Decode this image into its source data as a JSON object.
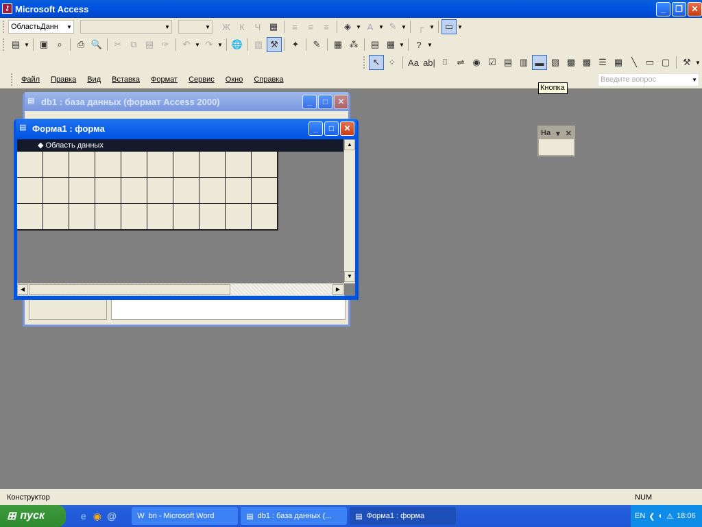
{
  "app": {
    "title": "Microsoft Access"
  },
  "toolbar_format": {
    "object_combo": "ОбластьДанн",
    "font_combo": "",
    "size_combo": "",
    "buttons": [
      {
        "name": "bold-icon",
        "g": "Ж",
        "d": 1
      },
      {
        "name": "italic-icon",
        "g": "К",
        "d": 1
      },
      {
        "name": "underline-icon",
        "g": "Ч",
        "d": 1
      },
      {
        "name": "table-format-icon",
        "g": "▦"
      },
      {
        "sep": 1
      },
      {
        "name": "align-left-icon",
        "g": "≡",
        "d": 1
      },
      {
        "name": "align-center-icon",
        "g": "≡",
        "d": 1
      },
      {
        "name": "align-right-icon",
        "g": "≡",
        "d": 1
      },
      {
        "sep": 1
      },
      {
        "name": "fill-color-icon",
        "g": "◈",
        "dd": 1
      },
      {
        "name": "font-color-icon",
        "g": "A",
        "d": 1,
        "dd": 1
      },
      {
        "name": "line-color-icon",
        "g": "✎",
        "d": 1,
        "dd": 1
      },
      {
        "sep": 1
      },
      {
        "name": "border-icon",
        "g": "┌",
        "d": 1,
        "dd": 1
      },
      {
        "sep": 1
      },
      {
        "name": "special-effect-icon",
        "g": "▭",
        "a": 1,
        "dd": 1
      }
    ]
  },
  "toolbar_design": {
    "buttons": [
      {
        "name": "view-icon",
        "g": "▤",
        "dd": 1
      },
      {
        "sep": 1
      },
      {
        "name": "save-icon",
        "g": "▣"
      },
      {
        "name": "search-file-icon",
        "g": "⌕"
      },
      {
        "sep": 1
      },
      {
        "name": "print-icon",
        "g": "⎙"
      },
      {
        "name": "print-preview-icon",
        "g": "🔍"
      },
      {
        "sep": 1
      },
      {
        "name": "cut-icon",
        "g": "✂",
        "d": 1
      },
      {
        "name": "copy-icon",
        "g": "⧉",
        "d": 1
      },
      {
        "name": "paste-icon",
        "g": "▤",
        "d": 1
      },
      {
        "name": "format-painter-icon",
        "g": "✑",
        "d": 1
      },
      {
        "sep": 1
      },
      {
        "name": "undo-icon",
        "g": "↶",
        "d": 1,
        "dd": 1
      },
      {
        "name": "redo-icon",
        "g": "↷",
        "d": 1,
        "dd": 1
      },
      {
        "sep": 1
      },
      {
        "name": "hyperlink-icon",
        "g": "🌐"
      },
      {
        "sep": 1
      },
      {
        "name": "field-list-icon",
        "g": "▥",
        "d": 1
      },
      {
        "name": "toolbox-icon",
        "g": "⚒",
        "a": 1
      },
      {
        "sep": 1
      },
      {
        "name": "autoformat-icon",
        "g": "✦"
      },
      {
        "sep": 1
      },
      {
        "name": "code-icon",
        "g": "✎"
      },
      {
        "sep": 1
      },
      {
        "name": "properties-icon",
        "g": "▦"
      },
      {
        "name": "builder-icon",
        "g": "⁂"
      },
      {
        "sep": 1
      },
      {
        "name": "database-window-icon",
        "g": "▤"
      },
      {
        "name": "new-object-icon",
        "g": "▦",
        "dd": 1
      },
      {
        "sep": 1
      },
      {
        "name": "help-icon",
        "g": "?",
        "dd": 1
      }
    ]
  },
  "toolbox": {
    "buttons": [
      {
        "name": "select-objects-icon",
        "g": "↖",
        "a": 1
      },
      {
        "name": "control-wizards-icon",
        "g": "⁘"
      },
      {
        "sep": 1
      },
      {
        "name": "label-icon",
        "g": "Aa"
      },
      {
        "name": "text-box-icon",
        "g": "ab|"
      },
      {
        "name": "option-group-icon",
        "g": "⌷"
      },
      {
        "name": "toggle-button-icon",
        "g": "⇌"
      },
      {
        "name": "option-button-icon",
        "g": "◉"
      },
      {
        "name": "check-box-icon",
        "g": "☑"
      },
      {
        "name": "combo-box-icon",
        "g": "▤"
      },
      {
        "name": "list-box-icon",
        "g": "▥"
      },
      {
        "name": "command-button-icon",
        "g": "▬",
        "a": 1
      },
      {
        "name": "image-icon",
        "g": "▨"
      },
      {
        "name": "unbound-object-frame-icon",
        "g": "▩"
      },
      {
        "name": "bound-object-frame-icon",
        "g": "▩"
      },
      {
        "name": "page-break-icon",
        "g": "☰"
      },
      {
        "name": "tab-control-icon",
        "g": "▦"
      },
      {
        "name": "line-icon",
        "g": "╲"
      },
      {
        "name": "rectangle-icon",
        "g": "▭"
      },
      {
        "name": "subform-icon",
        "g": "▢"
      },
      {
        "sep": 1
      },
      {
        "name": "more-controls-icon",
        "g": "⚒",
        "dd": 1
      }
    ]
  },
  "menu": [
    "Файл",
    "Правка",
    "Вид",
    "Вставка",
    "Формат",
    "Сервис",
    "Окно",
    "Справка"
  ],
  "ask_placeholder": "Введите вопрос",
  "tooltip": "Кнопка",
  "db_window": {
    "title": "db1 : база данных (формат Access 2000)"
  },
  "form_window": {
    "title": "Форма1 : форма",
    "section": "Область данных"
  },
  "float_toolbar": {
    "title": "На"
  },
  "status": {
    "left": "Конструктор",
    "num": "NUM"
  },
  "taskbar": {
    "start": "пуск",
    "tasks": [
      "bn - Microsoft Word",
      "db1 : база данных (...",
      "Форма1 : форма"
    ],
    "lang": "EN",
    "time": "18:06"
  }
}
